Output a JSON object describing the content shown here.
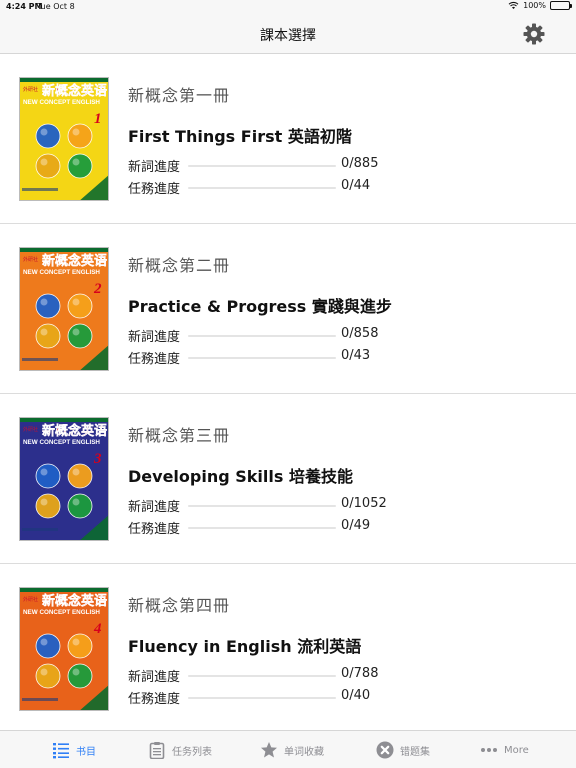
{
  "status_bar": {
    "time": "4:24 PM",
    "date": "Tue Oct 8",
    "battery": "100%"
  },
  "nav": {
    "title": "課本選擇",
    "settings_icon": "gear-icon"
  },
  "books": [
    {
      "series": "新概念第一冊",
      "title": "First Things First 英語初階",
      "new_words_label": "新詞進度",
      "new_words_value": "0/885",
      "new_words_progress": 0,
      "tasks_label": "任務進度",
      "tasks_value": "0/44",
      "tasks_progress": 0,
      "cover": {
        "publisher": "外研社",
        "name": "新概念英语",
        "english": "NEW CONCEPT ENGLISH",
        "number": "1",
        "color": "#f4d615"
      }
    },
    {
      "series": "新概念第二冊",
      "title": "Practice & Progress 實踐與進步",
      "new_words_label": "新詞進度",
      "new_words_value": "0/858",
      "new_words_progress": 0,
      "tasks_label": "任務進度",
      "tasks_value": "0/43",
      "tasks_progress": 0,
      "cover": {
        "publisher": "外研社",
        "name": "新概念英语",
        "english": "NEW CONCEPT ENGLISH",
        "number": "2",
        "color": "#ee7a1c"
      }
    },
    {
      "series": "新概念第三冊",
      "title": "Developing Skills 培養技能",
      "new_words_label": "新詞進度",
      "new_words_value": "0/1052",
      "new_words_progress": 0,
      "tasks_label": "任務進度",
      "tasks_value": "0/49",
      "tasks_progress": 0,
      "cover": {
        "publisher": "外研社",
        "name": "新概念英语",
        "english": "NEW CONCEPT ENGLISH",
        "number": "3",
        "color": "#2c2f8c"
      }
    },
    {
      "series": "新概念第四冊",
      "title": "Fluency in English 流利英語",
      "new_words_label": "新詞進度",
      "new_words_value": "0/788",
      "new_words_progress": 0,
      "tasks_label": "任務進度",
      "tasks_value": "0/40",
      "tasks_progress": 0,
      "cover": {
        "publisher": "外研社",
        "name": "新概念英语",
        "english": "NEW CONCEPT ENGLISH",
        "number": "4",
        "color": "#e8621a"
      }
    }
  ],
  "tabs": [
    {
      "label": "书目",
      "icon": "list-icon",
      "active": true
    },
    {
      "label": "任务列表",
      "icon": "clipboard-icon",
      "active": false
    },
    {
      "label": "单词收藏",
      "icon": "star-icon",
      "active": false
    },
    {
      "label": "错题集",
      "icon": "x-circle-icon",
      "active": false
    },
    {
      "label": "More",
      "icon": "more-icon",
      "active": false
    }
  ],
  "colors": {
    "accent": "#2f7ff6",
    "inactive": "#8e8e93",
    "bar_bg": "#f7f7f7"
  }
}
